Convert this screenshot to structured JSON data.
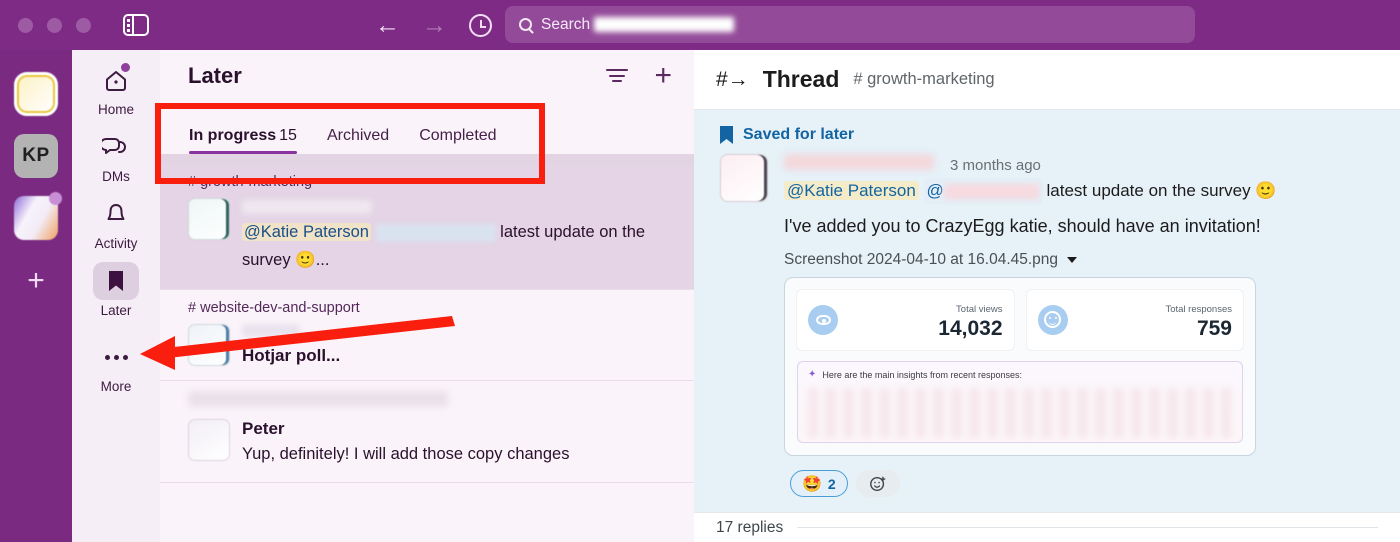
{
  "titlebar": {
    "sidebar_toggle_icon": "sidebar-toggle-icon",
    "back_icon": "←",
    "forward_icon": "→",
    "history_icon": "clock-icon",
    "search": {
      "label": "Search",
      "redacted_value": ""
    }
  },
  "workspace_rail": {
    "items": [
      {
        "name": "workspace-active",
        "label": ""
      },
      {
        "name": "workspace-kp",
        "label": "KP"
      },
      {
        "name": "workspace-other",
        "label": ""
      }
    ],
    "add_label": "+"
  },
  "nav": {
    "items": [
      {
        "label": "Home",
        "icon": "home-icon",
        "selected": false,
        "badge": true
      },
      {
        "label": "DMs",
        "icon": "dms-icon",
        "selected": false,
        "badge": false
      },
      {
        "label": "Activity",
        "icon": "bell-icon",
        "selected": false,
        "badge": false
      },
      {
        "label": "Later",
        "icon": "bookmark-icon",
        "selected": true,
        "badge": false
      },
      {
        "label": "More",
        "icon": "ellipsis-icon",
        "selected": false,
        "badge": false
      }
    ]
  },
  "later": {
    "title": "Later",
    "filter_icon": "filter-icon",
    "add_icon": "plus-icon",
    "tabs": [
      {
        "label": "In progress",
        "count": "15",
        "active": true
      },
      {
        "label": "Archived",
        "count": "",
        "active": false
      },
      {
        "label": "Completed",
        "count": "",
        "active": false
      }
    ],
    "rows": [
      {
        "channel": "# growth-marketing",
        "author": "",
        "mention": "@Katie Paterson",
        "mention2": "@",
        "text": " latest update on the survey 🙂...",
        "highlighted": true
      },
      {
        "channel": "# website-dev-and-support",
        "author": "",
        "title": "Hotjar poll...",
        "highlighted": false
      },
      {
        "channel": "",
        "author": "",
        "title": "Peter",
        "text": "Yup, definitely! I will add those copy changes",
        "highlighted": false
      }
    ]
  },
  "thread": {
    "icon": "#→",
    "title": "Thread",
    "channel": "# growth-marketing",
    "saved_label": "Saved for later",
    "saved_icon": "bookmark-icon",
    "message": {
      "author": "",
      "timestamp": "3 months ago",
      "mention1": "@Katie Paterson",
      "mention2": "@",
      "line1_tail": " latest update on the survey 🙂",
      "line2": "I've added you to CrazyEgg katie, should have an invitation!",
      "filename": "Screenshot 2024-04-10 at 16.04.45.png",
      "file_caret_icon": "chevron-down-icon"
    },
    "attachment": {
      "stats": [
        {
          "label": "Total views",
          "value": "14,032",
          "icon": "eye-icon"
        },
        {
          "label": "Total responses",
          "value": "759",
          "icon": "smiley-icon"
        }
      ],
      "insights_title": "Here are the main insights from recent responses:",
      "insights_icon": "sparkle-icon"
    },
    "reactions": [
      {
        "emoji": "🤩",
        "count": "2"
      }
    ],
    "add_reaction_icon": "add-reaction-icon",
    "replies_label": "17 replies"
  },
  "annotations": {
    "box_color": "#fa1e0e",
    "arrow_color": "#fa1e0e"
  }
}
